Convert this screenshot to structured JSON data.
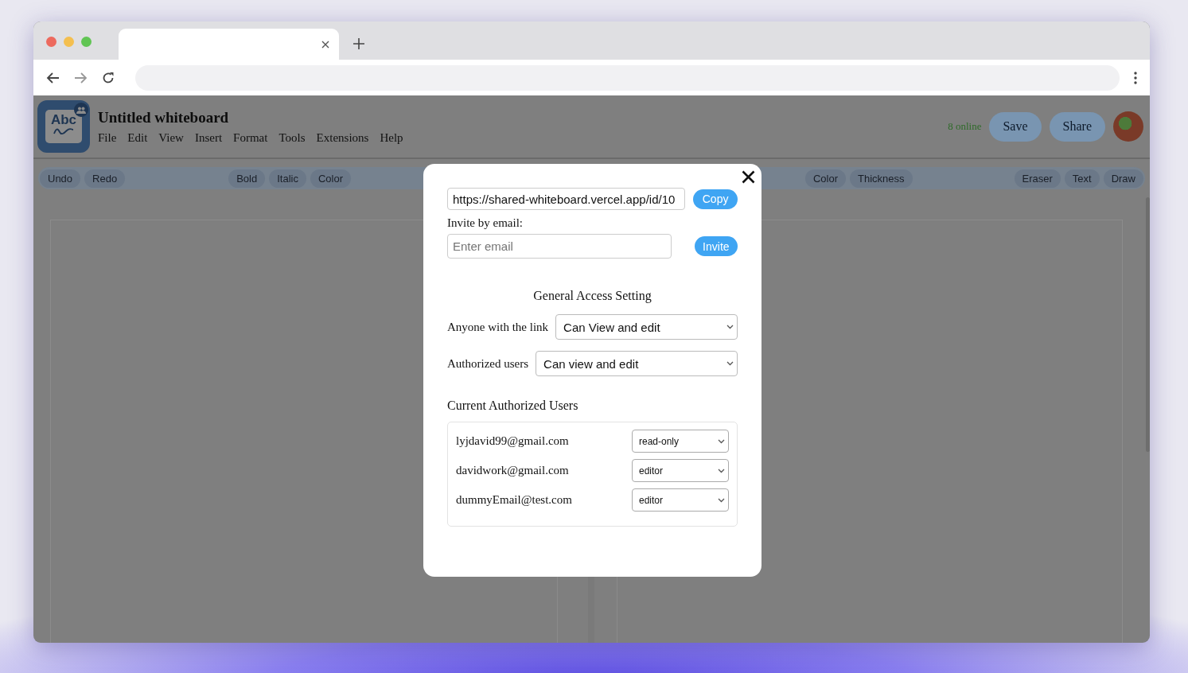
{
  "app": {
    "logo_text": "Abc",
    "title": "Untitled whiteboard",
    "menu": [
      "File",
      "Edit",
      "View",
      "Insert",
      "Format",
      "Tools",
      "Extensions",
      "Help"
    ],
    "online": "8 online",
    "buttons": [
      "Save",
      "Share"
    ]
  },
  "toolbar": [
    [
      "Undo",
      "Redo"
    ],
    [
      "Bold",
      "Italic",
      "Color"
    ],
    [
      "Color",
      "Thickness"
    ],
    [
      "Eraser",
      "Text",
      "Draw"
    ]
  ],
  "share_dialog": {
    "link": "https://shared-whiteboard.vercel.app/id/10",
    "copy_button": "Copy",
    "invite_label": "Invite by email:",
    "email_placeholder": "Enter email",
    "invite_button": "Invite",
    "access_heading": "General Access Setting",
    "access": [
      {
        "label": "Anyone with the link",
        "value": "Can View and edit"
      },
      {
        "label": "Authorized users",
        "value": "Can view and edit"
      }
    ],
    "users_heading": "Current Authorized Users",
    "users": [
      {
        "email": "lyjdavid99@gmail.com",
        "role": "read-only"
      },
      {
        "email": "davidwork@gmail.com",
        "role": "editor"
      },
      {
        "email": "dummyEmail@test.com",
        "role": "editor"
      }
    ]
  }
}
